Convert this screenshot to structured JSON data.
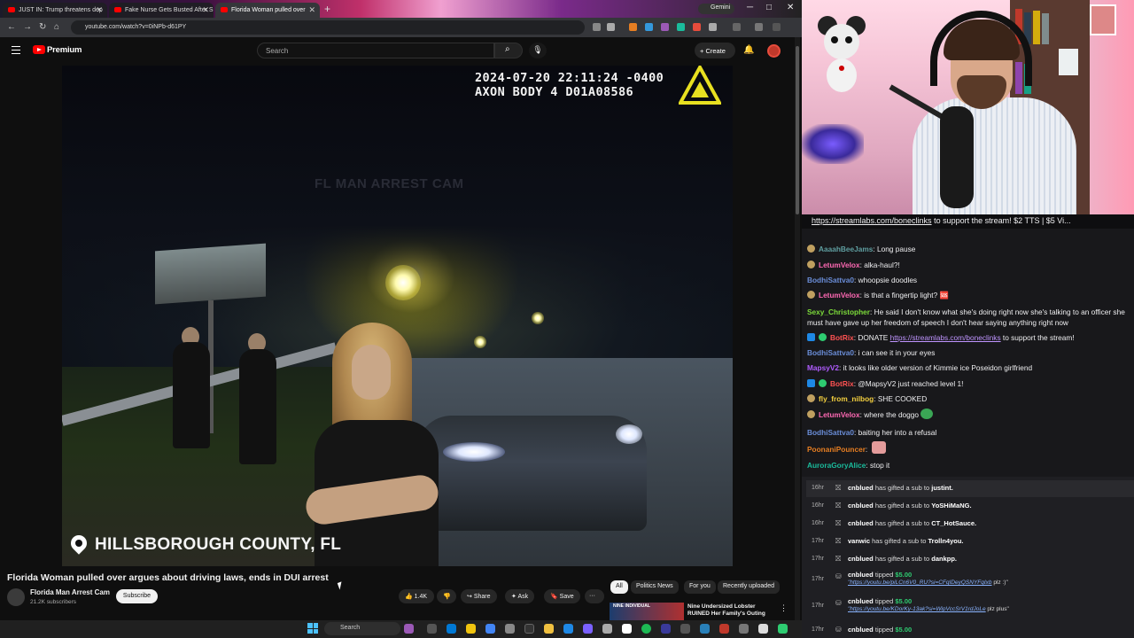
{
  "browser": {
    "tabs": [
      {
        "title": "JUST IN: Trump threatens dep"
      },
      {
        "title": "Fake Nurse Gets Busted After S"
      },
      {
        "title": "Florida Woman pulled over"
      }
    ],
    "new_tab": "+",
    "gemini_label": "Gemini",
    "url": "youtube.com/watch?v=0iNPb-d61PY",
    "win_min": "─",
    "win_max": "□",
    "win_close": "✕"
  },
  "youtube": {
    "brand": "Premium",
    "search_placeholder": "Search",
    "create_label": "+ Create",
    "video": {
      "timestamp": "2024-07-20 22:11:24 -0400",
      "camera_id": "AXON BODY 4 D01A08586",
      "watermark": "FL MAN ARREST CAM",
      "location": "HILLSBOROUGH COUNTY, FL",
      "title": "Florida Woman pulled over argues about driving laws, ends in DUI arrest"
    },
    "channel": {
      "name": "Florida Man Arrest Cam",
      "subscribers": "21.2K subscribers",
      "subscribe_label": "Subscribe"
    },
    "actions": {
      "likes": "1.4K",
      "share": "Share",
      "ask": "Ask",
      "save": "Save",
      "more": "···"
    },
    "chips": [
      "All",
      "Politics News",
      "For you",
      "Recently uploaded"
    ],
    "recommended": {
      "title": "Nine Undersized Lobster RUINED Her Family's Outing",
      "thumb_text": "NINE INDIVIDUAL"
    }
  },
  "taskbar": {
    "search_placeholder": "Search"
  },
  "stream": {
    "ticker_link": "https://streamlabs.com/boneclinks",
    "ticker_rest": " to support the stream! $2 TTS | $5 Vi..."
  },
  "chat": [
    {
      "user": "AaaahBeeJams",
      "color": "#5f9ea0",
      "text": "Long pause"
    },
    {
      "user": "LetumVelox",
      "color": "#ff69b4",
      "text": "alka-haul?!"
    },
    {
      "user": "BodhiSattva0",
      "color": "#6a8dd8",
      "text": "whoopsie doodles"
    },
    {
      "user": "LetumVelox",
      "color": "#ff69b4",
      "text": "is that a fingertip light? 🆘"
    },
    {
      "user": "Sexy_Christopher",
      "color": "#7cdb3a",
      "text": "He said I don't know what she's doing right now she's talking to an officer she must have gave up her freedom of speech I don't hear saying anything right now"
    },
    {
      "user": "BotRix",
      "color": "#ff5252",
      "pre": "DONATE ",
      "link": "https://streamlabs.com/boneclinks",
      "text": " to support the stream!"
    },
    {
      "user": "BodhiSattva0",
      "color": "#6a8dd8",
      "text": "i can see it in your eyes"
    },
    {
      "user": "MapsyV2",
      "color": "#b05cff",
      "text": "it looks like older version of Kimmie ice Poseidon girlfriend"
    },
    {
      "user": "BotRix",
      "color": "#ff5252",
      "text": "@MapsyV2 just reached level 1!"
    },
    {
      "user": "fly_from_nilbog",
      "color": "#f4d03f",
      "text": "SHE COOKED"
    },
    {
      "user": "LetumVelox",
      "color": "#ff69b4",
      "text": "where the doggo"
    },
    {
      "user": "BodhiSattva0",
      "color": "#6a8dd8",
      "text": "baiting her into a refusal"
    },
    {
      "user": "PoonaniPouncer",
      "color": "#e67e22",
      "text": ""
    },
    {
      "user": "AuroraGoryAlice",
      "color": "#1abc9c",
      "text": "stop it"
    }
  ],
  "events": [
    {
      "time": "16hr",
      "user": "cnblued",
      "action": "has gifted a sub to",
      "target": "justint."
    },
    {
      "time": "16hr",
      "user": "cnblued",
      "action": "has gifted a sub to",
      "target": "YoSHiMaNG."
    },
    {
      "time": "16hr",
      "user": "cnblued",
      "action": "has gifted a sub to",
      "target": "CT_HotSauce."
    },
    {
      "time": "17hr",
      "user": "vanwic",
      "action": "has gifted a sub to",
      "target": "Trolln4you."
    },
    {
      "time": "17hr",
      "user": "cnblued",
      "action": "has gifted a sub to",
      "target": "dankpp."
    },
    {
      "time": "17hr",
      "user": "cnblued",
      "action": "tipped",
      "amount": "$5.00",
      "msg_link": "\"https://youtu.be/piLCn6V0_RU?si=CFqIDeyQSNYFqIxb",
      "msg_rest": " plz :)\""
    },
    {
      "time": "17hr",
      "user": "cnblued",
      "action": "tipped",
      "amount": "$5.00",
      "msg_link": "\"https://youtu.be/KDorKy-13ak?si=WipVccSrV1rdJoLe",
      "msg_rest": " plz plus\""
    },
    {
      "time": "17hr",
      "user": "cnblued",
      "action": "tipped",
      "amount": "$5.00"
    }
  ]
}
